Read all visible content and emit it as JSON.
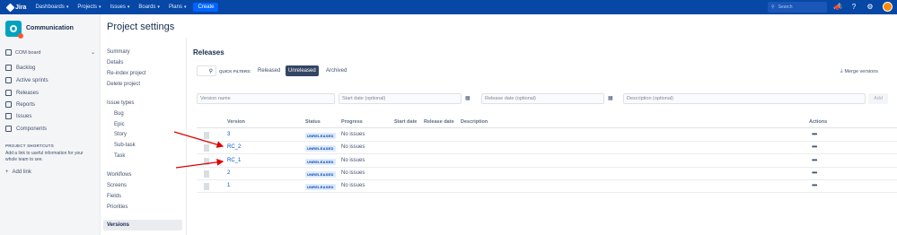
{
  "topbar": {
    "logo": "Jira",
    "nav": [
      {
        "label": "Dashboards"
      },
      {
        "label": "Projects"
      },
      {
        "label": "Issues"
      },
      {
        "label": "Boards"
      },
      {
        "label": "Plans"
      }
    ],
    "create_label": "Create",
    "search_placeholder": "Search"
  },
  "sidebar": {
    "project_name": "Communication",
    "board_label": "COM board",
    "items": [
      {
        "label": "Backlog"
      },
      {
        "label": "Active sprints"
      },
      {
        "label": "Releases"
      },
      {
        "label": "Reports"
      },
      {
        "label": "Issues"
      },
      {
        "label": "Components"
      }
    ],
    "shortcuts_title": "PROJECT SHORTCUTS",
    "shortcuts_desc": "Add a link to useful information for your whole team to see.",
    "add_link": "Add link"
  },
  "page_title": "Project settings",
  "settings_nav": {
    "summary": "Summary",
    "details": "Details",
    "reindex": "Re-index project",
    "delete": "Delete project",
    "issue_types": "Issue types",
    "bug": "Bug",
    "epic": "Epic",
    "story": "Story",
    "subtask": "Sub-task",
    "task": "Task",
    "workflows": "Workflows",
    "screens": "Screens",
    "fields": "Fields",
    "priorities": "Priorities",
    "versions": "Versions"
  },
  "releases": {
    "title": "Releases",
    "quick_filters_label": "QUICK FILTERS:",
    "filters": [
      "Released",
      "Unreleased",
      "Archived"
    ],
    "active_filter": "Unreleased",
    "merge_label": "Merge versions",
    "form": {
      "version_name": "Version name",
      "start_date": "Start date (optional)",
      "release_date": "Release date (optional)",
      "description": "Description (optional)",
      "add_label": "Add"
    },
    "columns": {
      "version": "Version",
      "status": "Status",
      "progress": "Progress",
      "start_date": "Start date",
      "release_date": "Release date",
      "description": "Description",
      "actions": "Actions"
    },
    "rows": [
      {
        "version": "3",
        "status": "UNRELEASED",
        "progress": "No issues"
      },
      {
        "version": "RC_2",
        "status": "UNRELEASED",
        "progress": "No issues"
      },
      {
        "version": "RC_1",
        "status": "UNRELEASED",
        "progress": "No issues"
      },
      {
        "version": "2",
        "status": "UNRELEASED",
        "progress": "No issues"
      },
      {
        "version": "1",
        "status": "UNRELEASED",
        "progress": "No issues"
      }
    ]
  },
  "colors": {
    "topbar": "#0747a6",
    "annotation_arrow": "#e00000",
    "link": "#0052cc"
  }
}
